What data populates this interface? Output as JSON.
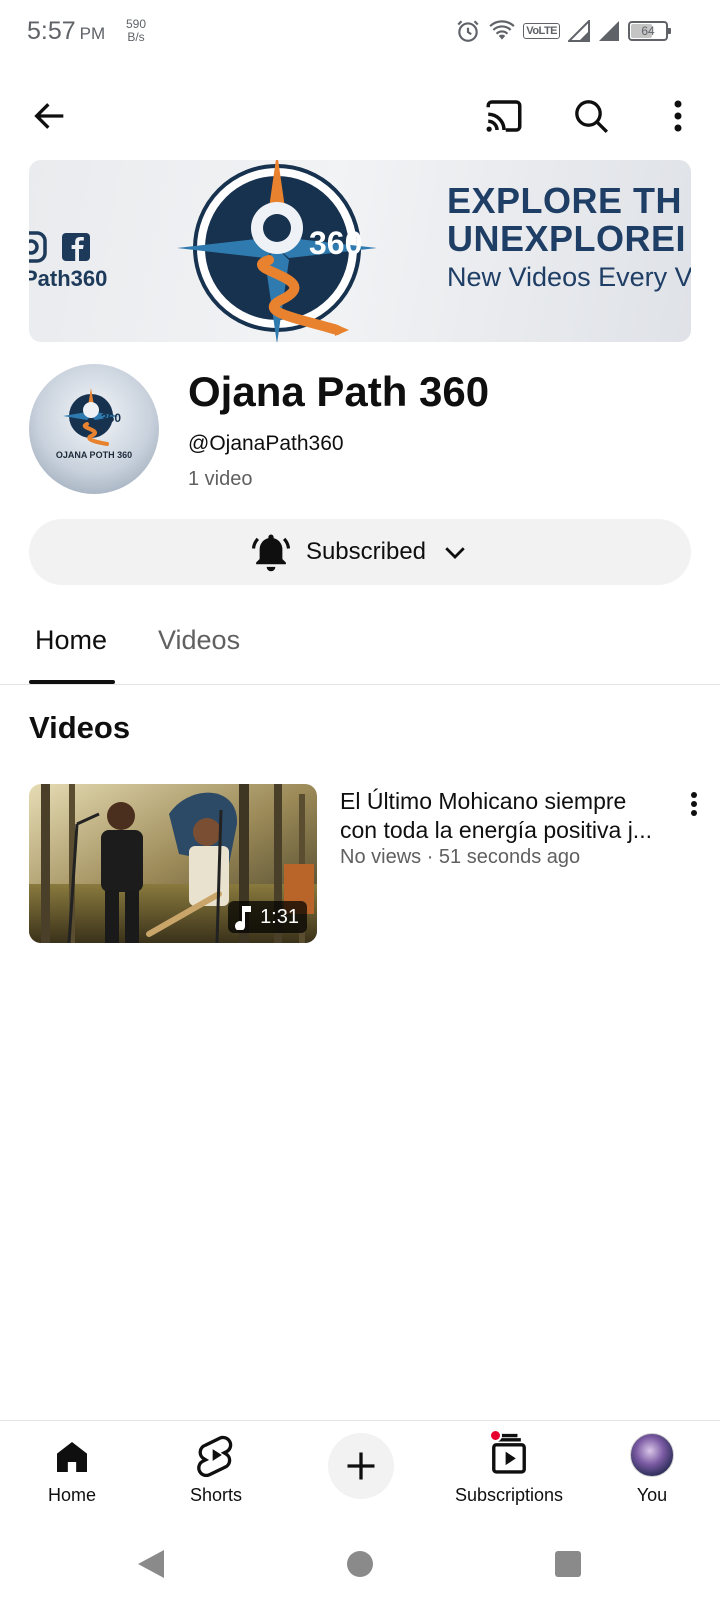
{
  "status_bar": {
    "time": "5:57",
    "ampm": "PM",
    "net_speed_value": "590",
    "net_speed_unit": "B/s",
    "volte": "VoLTE",
    "battery_level": "64",
    "battery_fraction": 0.64,
    "icons": [
      "alarm-icon",
      "wifi-icon",
      "volte-icon",
      "signal-icon",
      "signal-icon",
      "battery-icon"
    ]
  },
  "top_bar": {
    "icons": [
      "back-arrow-icon",
      "cast-icon",
      "search-icon",
      "more-vert-icon"
    ]
  },
  "banner": {
    "handle": "Path360",
    "logo_text": "360",
    "headline_1": "EXPLORE TH",
    "headline_2": "UNEXPLOREI",
    "subline": "New Videos Every V"
  },
  "channel": {
    "avatar_caption": "OJANA POTH 360",
    "avatar_logo_text": "360",
    "name": "Ojana Path 360",
    "handle": "@OjanaPath360",
    "video_count": "1 video",
    "subscribe_label": "Subscribed"
  },
  "tabs": [
    {
      "label": "Home",
      "selected": true
    },
    {
      "label": "Videos",
      "selected": false
    }
  ],
  "section_title": "Videos",
  "videos": [
    {
      "title_line_1": "El Último Mohicano   siempre",
      "title_line_2": "con toda la energía positiva j...",
      "meta": "No views · 51 seconds ago",
      "duration": "1:31"
    }
  ],
  "bottom_nav": [
    {
      "label": "Home",
      "icon": "home-icon"
    },
    {
      "label": "Shorts",
      "icon": "shorts-icon"
    },
    {
      "label": "",
      "icon": "plus-icon"
    },
    {
      "label": "Subscriptions",
      "icon": "subscriptions-icon"
    },
    {
      "label": "You",
      "icon": "avatar"
    }
  ],
  "colors": {
    "text_primary": "#0f0f0f",
    "text_secondary": "#606060",
    "chip_bg": "#f2f2f2",
    "notification_red": "#e6002e",
    "banner_navy": "#1f3e66",
    "brand_orange": "#e8822e"
  }
}
